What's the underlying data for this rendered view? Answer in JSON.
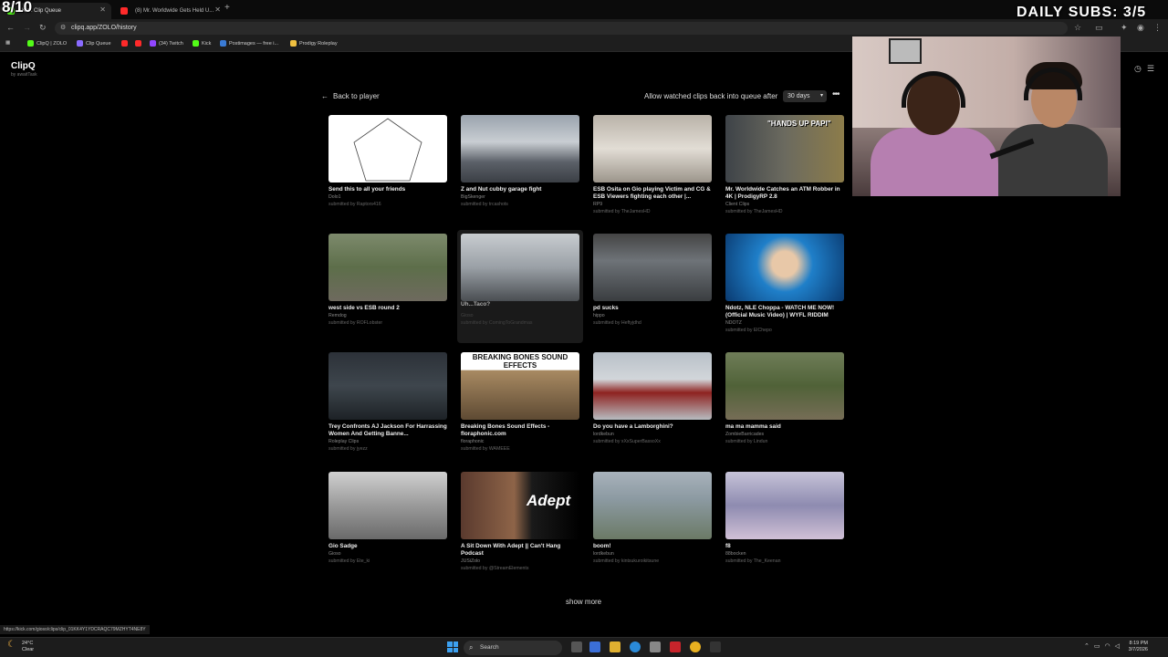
{
  "overlay": {
    "counter": "8/10",
    "subs": "DAILY SUBS: 3/5"
  },
  "browser": {
    "tabs": [
      {
        "label": "Kick Clip Queue",
        "color": "#53fc18"
      },
      {
        "label": "(8) Mr. Worldwide Gets Held U...",
        "color": "#ff2a2a"
      }
    ],
    "url": "clipq.app/ZOLO/history",
    "bookmarks": [
      {
        "label": "ClipQ | ZOLO",
        "color": "#53fc18"
      },
      {
        "label": "Clip Queue",
        "color": "#8a6bff"
      },
      {
        "label": "",
        "color": "#ff2a2a"
      },
      {
        "label": "",
        "color": "#ff2a2a"
      },
      {
        "label": "(34) Twitch",
        "color": "#9146ff"
      },
      {
        "label": "Kick",
        "color": "#53fc18"
      },
      {
        "label": "Postimages — free i...",
        "color": "#3a7bd5"
      },
      {
        "label": "Prodigy Roleplay",
        "color": "#f0c040"
      }
    ],
    "status_url": "https://kick.com/gioso/clips/clip_01KK4Y1YDCRAQC79MZHYT4NE8Y"
  },
  "app": {
    "brand": "ClipQ",
    "brand_sub": "by awaitTask",
    "back_label": "Back to player",
    "allow_label": "Allow watched clips back into queue after",
    "select_value": "30 days",
    "show_more": "show more"
  },
  "clips": [
    {
      "title": "Send this to all your friends",
      "author": "Dolo1",
      "submitted": "submitted by Raptors416",
      "thumb": "pentagon"
    },
    {
      "title": "Z and Nut cubby garage fight",
      "author": "BigSkenger",
      "submitted": "submitted by trcashots",
      "thumb": "garage"
    },
    {
      "title": "ESB Osita on Gio playing Victim and CG & ESB Viewers fighting each other |...",
      "author": "RP9",
      "submitted": "submitted by TheJamesHD",
      "thumb": "room"
    },
    {
      "title": "Mr. Worldwide Catches an ATM Robber in 4K | ProdigyRP 2.8",
      "author": "Client Clips",
      "submitted": "submitted by TheJamesHD",
      "thumb": "handsup",
      "thumb_text": "\"HANDS UP PAPI\""
    },
    {
      "title": "west side vs ESB round 2",
      "author": "Remdog",
      "submitted": "submitted by ROFLobster",
      "thumb": "street"
    },
    {
      "title": "Uh...Taco?",
      "author": "Gioso",
      "submitted": "submitted by ComingToGrandmas",
      "thumb": "taco",
      "hover": true
    },
    {
      "title": "pd sucks",
      "author": "hippo",
      "submitted": "submitted by Heftyjdhd",
      "thumb": "road"
    },
    {
      "title": "Ndotz, NLE Choppa - WATCH ME NOW! (Official Music Video) | WYFL RIDDIM",
      "author": "NDOTZ",
      "submitted": "submitted by ElChepo",
      "thumb": "music"
    },
    {
      "title": "Trey Confronts AJ Jackson For Harrassing Women And Getting Banne...",
      "author": "Roleplay Clips",
      "submitted": "submitted by jyezz",
      "thumb": "night"
    },
    {
      "title": "Breaking Bones Sound Effects - floraphonic.com",
      "author": "floraphonic",
      "submitted": "submitted by WAMEEE",
      "thumb": "bones",
      "thumb_text": "BREAKING BONES SOUND EFFECTS"
    },
    {
      "title": "Do you have a Lamborghini?",
      "author": "lordkebun",
      "submitted": "submitted by xXxSuperBassoXx",
      "thumb": "lambo"
    },
    {
      "title": "ma ma mamma said",
      "author": "ZombieBarricades",
      "submitted": "submitted by Lindun",
      "thumb": "yard"
    },
    {
      "title": "Gio Sadge",
      "author": "Gioso",
      "submitted": "submitted by Ete_ki",
      "thumb": "grey"
    },
    {
      "title": "A Sit Down With Adept || Can't Hang Podcast",
      "author": "JUSiZolo",
      "submitted": "submitted by @StreamElements",
      "thumb": "adept",
      "thumb_text": "Adept"
    },
    {
      "title": "boom!",
      "author": "lordkebun",
      "submitted": "submitted by kintsukuroikitsune",
      "thumb": "city"
    },
    {
      "title": "f8",
      "author": "88bocken",
      "submitted": "submitted by The_Keenan",
      "thumb": "door"
    }
  ],
  "taskbar": {
    "temp": "24°C",
    "condition": "Clear",
    "search": "Search",
    "time": "8:19 PM",
    "date": "3/7/2026"
  }
}
